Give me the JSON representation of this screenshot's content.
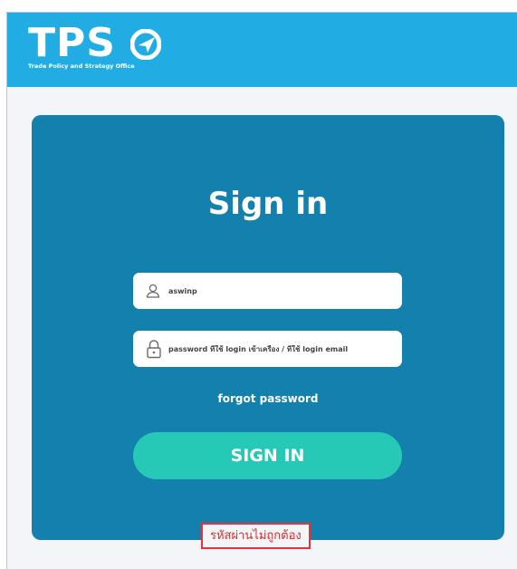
{
  "header": {
    "logo_text": "TPS",
    "logo_tagline": "Trade Policy and Strategy Office"
  },
  "form": {
    "title": "Sign in",
    "username_value": "aswinp",
    "password_placeholder": "password ที่ใช้ login เข้าเครื่อง / ที่ใช้ login email",
    "forgot_label": "forgot password",
    "submit_label": "SIGN IN"
  },
  "error_message": "รหัสผ่านไม่ถูกต้อง",
  "colors": {
    "header_bg": "#21ade3",
    "card_bg": "#1480ad",
    "button_bg": "#26c8b6",
    "error": "#e5333b"
  }
}
